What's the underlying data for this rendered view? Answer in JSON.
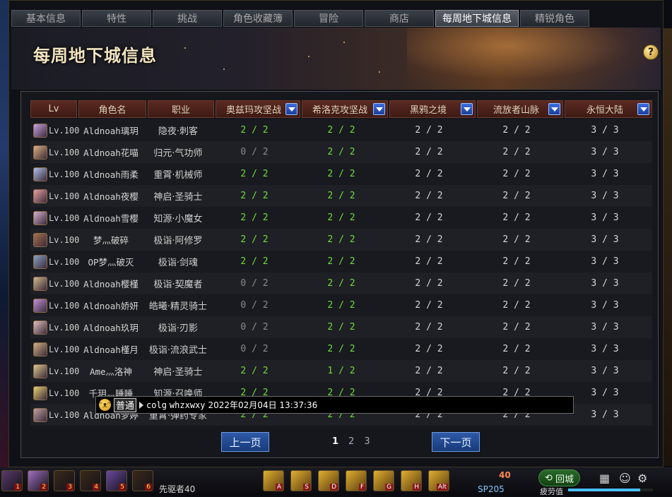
{
  "tabs": [
    {
      "label": "基本信息",
      "active": false
    },
    {
      "label": "特性",
      "active": false
    },
    {
      "label": "挑战",
      "active": false
    },
    {
      "label": "角色收藏簿",
      "active": false
    },
    {
      "label": "冒险",
      "active": false
    },
    {
      "label": "商店",
      "active": false
    },
    {
      "label": "每周地下城信息",
      "active": true
    },
    {
      "label": "精锐角色",
      "active": false
    }
  ],
  "page_title": "每周地下城信息",
  "help_icon": "?",
  "table": {
    "columns": {
      "lv": "Lv",
      "name": "角色名",
      "job": "职业",
      "d1": "奥兹玛攻坚战",
      "d2": "希洛克攻坚战",
      "d3": "黑鸦之境",
      "d4": "流放者山脉",
      "d5": "永恒大陆"
    },
    "rows": [
      {
        "lv": "Lv.100",
        "name": "Aldnoah璃玥",
        "job": "隐夜·刺客",
        "d1": "2 / 2",
        "d2": "2 / 2",
        "d3": "2 / 2",
        "d4": "2 / 2",
        "d5": "3 / 3"
      },
      {
        "lv": "Lv.100",
        "name": "Aldnoah花喵",
        "job": "归元·气功师",
        "d1": "0 / 2",
        "d2": "2 / 2",
        "d3": "2 / 2",
        "d4": "2 / 2",
        "d5": "3 / 3"
      },
      {
        "lv": "Lv.100",
        "name": "Aldnoah雨柔",
        "job": "重霄·机械师",
        "d1": "2 / 2",
        "d2": "2 / 2",
        "d3": "2 / 2",
        "d4": "2 / 2",
        "d5": "3 / 3"
      },
      {
        "lv": "Lv.100",
        "name": "Aldnoah夜樱",
        "job": "神启·圣骑士",
        "d1": "2 / 2",
        "d2": "2 / 2",
        "d3": "2 / 2",
        "d4": "2 / 2",
        "d5": "3 / 3"
      },
      {
        "lv": "Lv.100",
        "name": "Aldnoah雪樱",
        "job": "知源·小魔女",
        "d1": "2 / 2",
        "d2": "2 / 2",
        "d3": "2 / 2",
        "d4": "2 / 2",
        "d5": "3 / 3"
      },
      {
        "lv": "Lv.100",
        "name": "梦灬破碎",
        "job": "极诣·阿修罗",
        "d1": "2 / 2",
        "d2": "2 / 2",
        "d3": "2 / 2",
        "d4": "2 / 2",
        "d5": "3 / 3"
      },
      {
        "lv": "Lv.100",
        "name": "OP梦灬破灭",
        "job": "极诣·剑魂",
        "d1": "2 / 2",
        "d2": "2 / 2",
        "d3": "2 / 2",
        "d4": "2 / 2",
        "d5": "3 / 3"
      },
      {
        "lv": "Lv.100",
        "name": "Aldnoah樱槿",
        "job": "极诣·契魔者",
        "d1": "0 / 2",
        "d2": "2 / 2",
        "d3": "2 / 2",
        "d4": "2 / 2",
        "d5": "3 / 3"
      },
      {
        "lv": "Lv.100",
        "name": "Aldnoah娇妍",
        "job": "皓曦·精灵骑士",
        "d1": "0 / 2",
        "d2": "2 / 2",
        "d3": "2 / 2",
        "d4": "2 / 2",
        "d5": "3 / 3"
      },
      {
        "lv": "Lv.100",
        "name": "Aldnoah玖玥",
        "job": "极诣·刃影",
        "d1": "0 / 2",
        "d2": "2 / 2",
        "d3": "2 / 2",
        "d4": "2 / 2",
        "d5": "3 / 3"
      },
      {
        "lv": "Lv.100",
        "name": "Aldnoah槿月",
        "job": "极诣·流浪武士",
        "d1": "0 / 2",
        "d2": "2 / 2",
        "d3": "2 / 2",
        "d4": "2 / 2",
        "d5": "3 / 3"
      },
      {
        "lv": "Lv.100",
        "name": "Ame灬洛神",
        "job": "神启·圣骑士",
        "d1": "2 / 2",
        "d2": "1 / 2",
        "d3": "2 / 2",
        "d4": "2 / 2",
        "d5": "3 / 3"
      },
      {
        "lv": "Lv.100",
        "name": "千玥灬睡睡",
        "job": "知源·召唤师",
        "d1": "2 / 2",
        "d2": "2 / 2",
        "d3": "2 / 2",
        "d4": "2 / 2",
        "d5": "3 / 3"
      },
      {
        "lv": "Lv.100",
        "name": "Aldnoah梦婷",
        "job": "重霄·弹药专家",
        "d1": "2 / 2",
        "d2": "2 / 2",
        "d3": "2 / 2",
        "d4": "2 / 2",
        "d5": "3 / 3"
      }
    ]
  },
  "pagination": {
    "prev": "上一页",
    "next": "下一页",
    "pages": [
      "1",
      "2",
      "3"
    ],
    "current": "1"
  },
  "chat": {
    "channel": "普通",
    "sender": "colg",
    "message": "whzxwxy",
    "timestamp": "2022年02月04日 13:37:36"
  },
  "hud": {
    "title_text": "先驱者40",
    "level": "40",
    "sp": "SP205",
    "town_button": "回城",
    "fatigue_label": "疲劳值",
    "slot_keys": [
      "1",
      "2",
      "3",
      "4",
      "5",
      "6"
    ],
    "skill_keys": [
      "A",
      "S",
      "D",
      "F",
      "G",
      "H",
      "Alt"
    ],
    "fatigue_fraction": 0.85
  },
  "colors": {
    "done": "#6fdc3c",
    "not_done": "#8b8b8b",
    "accent": "#2f5aa8"
  }
}
